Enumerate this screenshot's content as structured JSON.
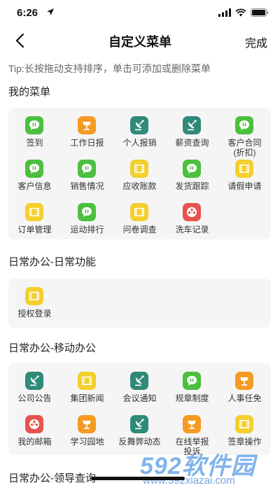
{
  "status_bar": {
    "time": "6:26"
  },
  "nav": {
    "title": "自定义菜单",
    "done_label": "完成"
  },
  "tip": "Tip:长按拖动支持排序，单击可添加或删除菜单",
  "sections": [
    {
      "title": "我的菜单",
      "items": [
        {
          "label": "签到",
          "icon": "chat-bubble-icon",
          "color": "#4cbf3f"
        },
        {
          "label": "工作日报",
          "icon": "lamp-icon",
          "color": "#f59a23"
        },
        {
          "label": "个人报销",
          "icon": "satellite-dish-icon",
          "color": "#2f8a78"
        },
        {
          "label": "薪资查询",
          "icon": "satellite-dish-icon",
          "color": "#2f8a78"
        },
        {
          "label": "客户合同\n(折扣)",
          "icon": "chat-bubble-icon",
          "color": "#4cbf3f"
        },
        {
          "label": "客户信息",
          "icon": "chat-bubble-icon",
          "color": "#4cbf3f"
        },
        {
          "label": "销售情况",
          "icon": "chat-bubble-icon",
          "color": "#4cbf3f"
        },
        {
          "label": "应收账款",
          "icon": "film-icon",
          "color": "#f4cf2e"
        },
        {
          "label": "发货跟踪",
          "icon": "chat-bubble-icon",
          "color": "#4cbf3f"
        },
        {
          "label": "请假申请",
          "icon": "film-icon",
          "color": "#f4cf2e"
        },
        {
          "label": "订单管理",
          "icon": "film-icon",
          "color": "#f4cf2e"
        },
        {
          "label": "运动排行",
          "icon": "chat-bubble-icon",
          "color": "#4cbf3f"
        },
        {
          "label": "问卷调查",
          "icon": "film-icon",
          "color": "#f4cf2e"
        },
        {
          "label": "洗车记录",
          "icon": "reel-icon",
          "color": "#e75450"
        }
      ]
    },
    {
      "title": "日常办公-日常功能",
      "items": [
        {
          "label": "授权登录",
          "icon": "film-icon",
          "color": "#f4cf2e"
        }
      ]
    },
    {
      "title": "日常办公-移动办公",
      "items": [
        {
          "label": "公司公告",
          "icon": "satellite-dish-icon",
          "color": "#2f8a78"
        },
        {
          "label": "集团新闻",
          "icon": "film-icon",
          "color": "#f4cf2e"
        },
        {
          "label": "会议通知",
          "icon": "satellite-dish-icon",
          "color": "#2f8a78"
        },
        {
          "label": "规章制度",
          "icon": "chat-bubble-icon",
          "color": "#4cbf3f"
        },
        {
          "label": "人事任免",
          "icon": "lamp-icon",
          "color": "#f59a23"
        },
        {
          "label": "我的邮箱",
          "icon": "reel-icon",
          "color": "#e75450"
        },
        {
          "label": "学习园地",
          "icon": "lamp-icon",
          "color": "#f59a23"
        },
        {
          "label": "反舞弊动态",
          "icon": "satellite-dish-icon",
          "color": "#2f8a78"
        },
        {
          "label": "在线举报\n投诉",
          "icon": "lamp-icon",
          "color": "#f59a23"
        },
        {
          "label": "签章操作",
          "icon": "film-icon",
          "color": "#f4cf2e"
        }
      ]
    },
    {
      "title": "日常办公-领导查询",
      "items": []
    }
  ],
  "watermark": {
    "brand": "592软件园",
    "url": "www.592xiazai.com"
  }
}
